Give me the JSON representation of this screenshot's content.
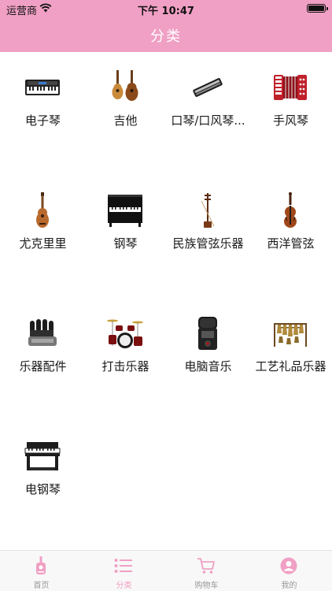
{
  "status_bar": {
    "carrier": "运营商",
    "time": "下午 10:47"
  },
  "header": {
    "title": "分类"
  },
  "categories": [
    {
      "label": "电子琴",
      "icon": "keyboard-icon"
    },
    {
      "label": "吉他",
      "icon": "guitar-icon"
    },
    {
      "label": "口琴/口风琴...",
      "icon": "harmonica-icon"
    },
    {
      "label": "手风琴",
      "icon": "accordion-icon"
    },
    {
      "label": "尤克里里",
      "icon": "ukulele-icon"
    },
    {
      "label": "钢琴",
      "icon": "piano-icon"
    },
    {
      "label": "民族管弦乐器",
      "icon": "erhu-icon"
    },
    {
      "label": "西洋管弦",
      "icon": "violin-icon"
    },
    {
      "label": "乐器配件",
      "icon": "finger-trainer-icon"
    },
    {
      "label": "打击乐器",
      "icon": "drum-kit-icon"
    },
    {
      "label": "电脑音乐",
      "icon": "audio-recorder-icon"
    },
    {
      "label": "工艺礼品乐器",
      "icon": "chime-icon"
    },
    {
      "label": "电钢琴",
      "icon": "digital-piano-icon"
    }
  ],
  "tabbar": {
    "items": [
      {
        "label": "首页",
        "icon": "home-guitar-icon"
      },
      {
        "label": "分类",
        "icon": "list-icon",
        "active": true
      },
      {
        "label": "购物车",
        "icon": "cart-icon"
      },
      {
        "label": "我的",
        "icon": "profile-icon"
      }
    ]
  },
  "colors": {
    "accent": "#f0a0c4",
    "tab_inactive": "#999999"
  }
}
